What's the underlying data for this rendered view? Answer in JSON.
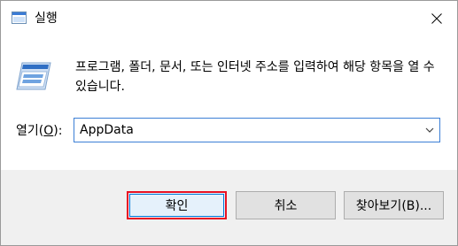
{
  "window": {
    "title": "실행",
    "close_icon": "close-icon"
  },
  "content": {
    "description": "프로그램, 폴더, 문서, 또는 인터넷 주소를 입력하여 해당 항목을 열 수 있습니다.",
    "open_label_prefix": "열기(",
    "open_label_mnemonic": "O",
    "open_label_suffix": "):",
    "combo_value": "AppData"
  },
  "buttons": {
    "ok": "확인",
    "cancel": "취소",
    "browse": "찾아보기(B)..."
  },
  "colors": {
    "accent": "#0078d7",
    "highlight_border": "#e81123",
    "footer_bg": "#f0f0f0"
  }
}
